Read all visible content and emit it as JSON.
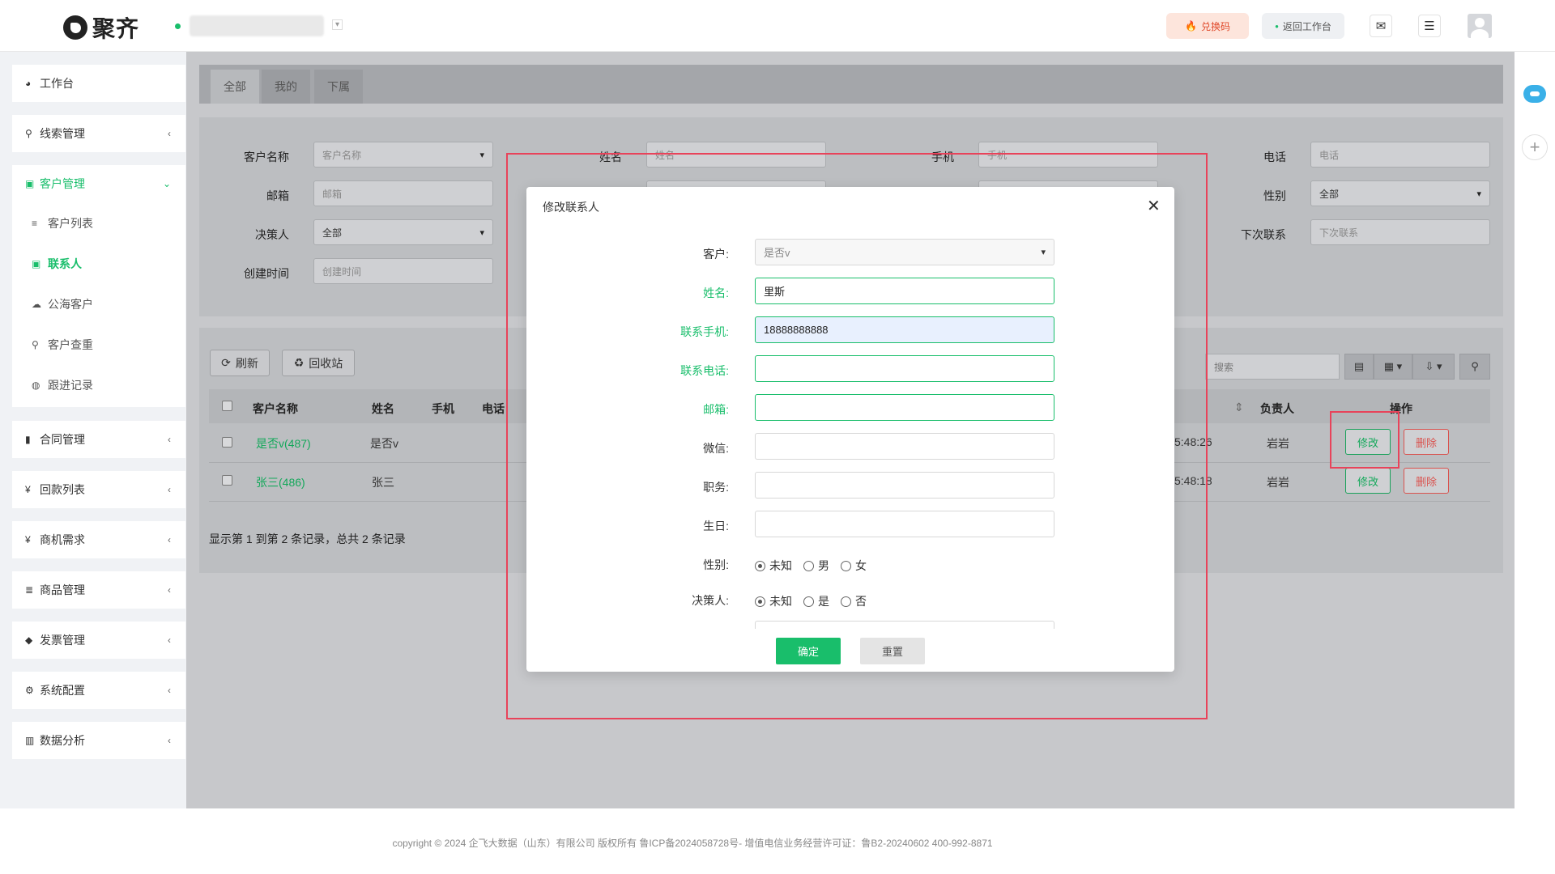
{
  "header": {
    "logo": "聚齐",
    "redeem_label": "兑换码",
    "back_label": "返回工作台"
  },
  "sidebar": {
    "groups": [
      {
        "label": "工作台",
        "icon": "dashboard-icon"
      },
      {
        "label": "线索管理",
        "icon": "link-icon"
      },
      {
        "label": "客户管理",
        "icon": "id-card-icon"
      },
      {
        "label": "合同管理",
        "icon": "bookmark-icon"
      },
      {
        "label": "回款列表",
        "icon": "yen-icon"
      },
      {
        "label": "商机需求",
        "icon": "yen-icon"
      },
      {
        "label": "商品管理",
        "icon": "list-icon"
      },
      {
        "label": "发票管理",
        "icon": "tag-icon"
      },
      {
        "label": "系统配置",
        "icon": "gears-icon"
      },
      {
        "label": "数据分析",
        "icon": "bar-chart-icon"
      }
    ],
    "sub_items": [
      {
        "label": "客户列表",
        "icon": "list-icon"
      },
      {
        "label": "联系人",
        "icon": "contact-icon"
      },
      {
        "label": "公海客户",
        "icon": "cloud-icon"
      },
      {
        "label": "客户查重",
        "icon": "search-icon"
      },
      {
        "label": "跟进记录",
        "icon": "comments-icon"
      }
    ]
  },
  "tabs": [
    "全部",
    "我的",
    "下属"
  ],
  "filters": {
    "customer_name": {
      "label": "客户名称",
      "placeholder": "客户名称"
    },
    "name": {
      "label": "姓名",
      "placeholder": "姓名"
    },
    "mobile": {
      "label": "手机",
      "placeholder": "手机"
    },
    "phone": {
      "label": "电话",
      "placeholder": "电话"
    },
    "email": {
      "label": "邮箱",
      "placeholder": "邮箱"
    },
    "gender": {
      "label": "性别",
      "value": "全部"
    },
    "decision": {
      "label": "决策人",
      "value": "全部"
    },
    "next_contact": {
      "label": "下次联系",
      "placeholder": "下次联系"
    },
    "created": {
      "label": "创建时间",
      "placeholder": "创建时间"
    }
  },
  "toolbar": {
    "refresh": "刷新",
    "recycle": "回收站",
    "search_placeholder": "搜索"
  },
  "table": {
    "headers": [
      "客户名称",
      "姓名",
      "手机",
      "电话",
      "负责人",
      "操作"
    ],
    "rows": [
      {
        "customer": "是否v(487)",
        "name": "是否v",
        "time": "5:48:26",
        "owner": "岩岩",
        "edit": "修改",
        "del": "删除"
      },
      {
        "customer": "张三(486)",
        "name": "张三",
        "time": "5:48:18",
        "owner": "岩岩",
        "edit": "修改",
        "del": "删除"
      }
    ],
    "pager": "显示第 1 到第 2 条记录，总共 2 条记录"
  },
  "modal": {
    "title": "修改联系人",
    "customer": {
      "label": "客户:",
      "value": "是否v"
    },
    "name": {
      "label": "姓名:",
      "value": "里斯"
    },
    "mobile": {
      "label": "联系手机:",
      "value": "18888888888"
    },
    "phone": {
      "label": "联系电话:",
      "value": ""
    },
    "email": {
      "label": "邮箱:",
      "value": ""
    },
    "wechat": {
      "label": "微信:",
      "value": ""
    },
    "position": {
      "label": "职务:",
      "value": ""
    },
    "birthday": {
      "label": "生日:",
      "value": ""
    },
    "gender": {
      "label": "性别:",
      "options": [
        "未知",
        "男",
        "女"
      ]
    },
    "decision": {
      "label": "决策人:",
      "options": [
        "未知",
        "是",
        "否"
      ]
    },
    "confirm": "确定",
    "reset": "重置"
  },
  "footer": {
    "text": "copyright © 2024 企飞大数据（山东）有限公司 版权所有  鲁ICP备2024058728号-  增值电信业务经营许可证：鲁B2-20240602  400-992-8871"
  },
  "colors": {
    "accent": "#19be6b",
    "danger": "#d9534f",
    "annotation": "#e8435a"
  }
}
